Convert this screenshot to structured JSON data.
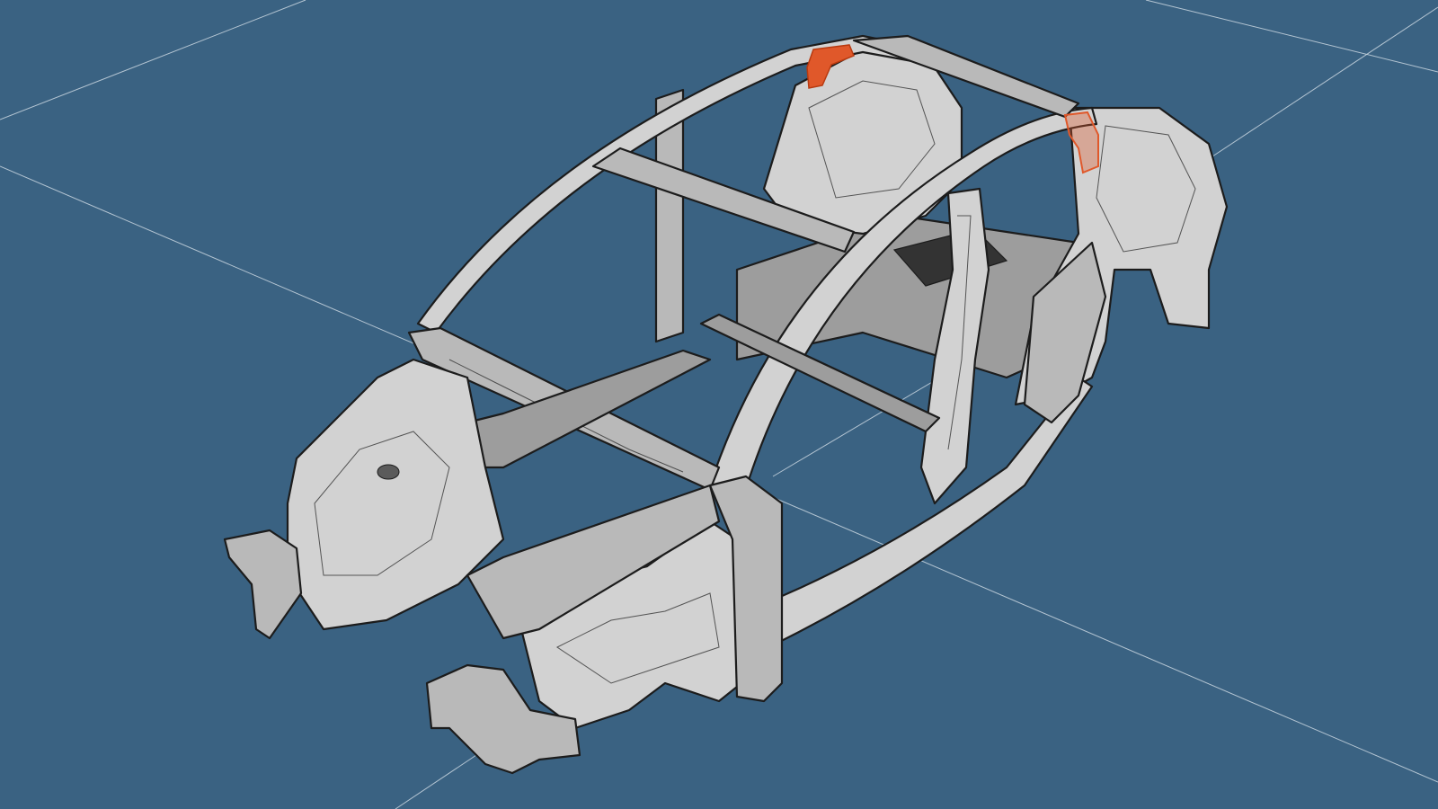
{
  "viewport": {
    "background_color": "#3a6282",
    "grid_color": "#c9d6e0",
    "part_color": "#b9b9b9",
    "highlight_color": "#e0582a"
  },
  "model": {
    "subject": "car-body-in-white-3d-model",
    "highlighted_parts": 2
  }
}
